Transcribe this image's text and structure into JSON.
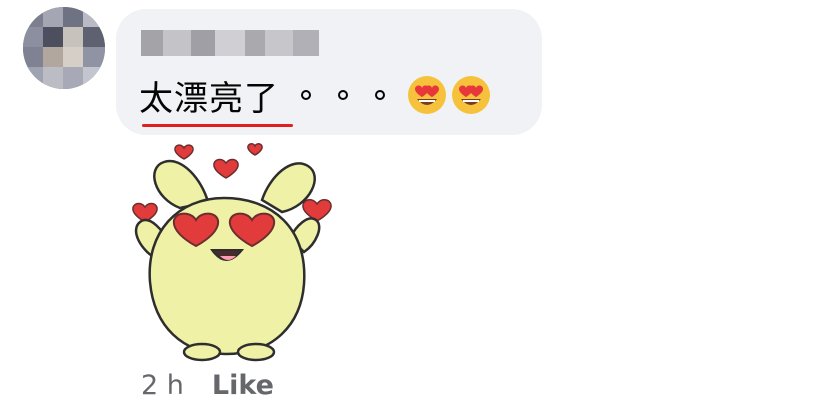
{
  "comment": {
    "text": "太漂亮了",
    "emojis": [
      "smiling-face-with-heart-eyes",
      "smiling-face-with-heart-eyes"
    ]
  },
  "footer": {
    "time": "2 h",
    "like_label": "Like"
  }
}
